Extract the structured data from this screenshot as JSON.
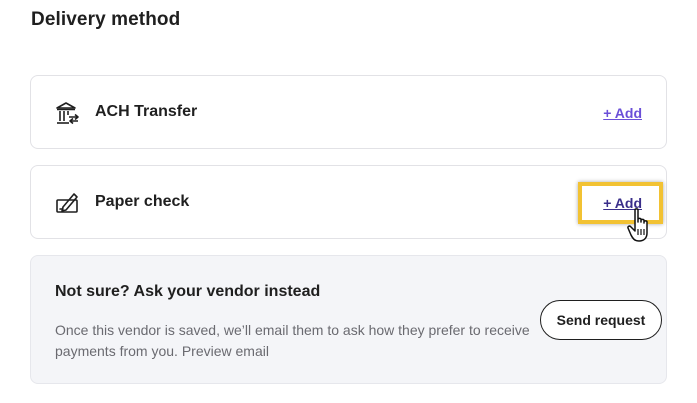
{
  "section": {
    "title": "Delivery method"
  },
  "methods": [
    {
      "label": "ACH Transfer",
      "icon": "bank-transfer-icon",
      "action_label": "+ Add"
    },
    {
      "label": "Paper check",
      "icon": "paper-check-icon",
      "action_label": "+ Add",
      "focused": true
    }
  ],
  "vendor_request": {
    "title": "Not sure? Ask your vendor instead",
    "description": "Once this vendor is saved, we’ll email them to ask how they prefer to receive payments from you. Preview email",
    "button_label": "Send request"
  },
  "colors": {
    "accent": "#6b4fd8",
    "focus_ring": "#f2c233",
    "muted_box": "#f4f5f8"
  }
}
